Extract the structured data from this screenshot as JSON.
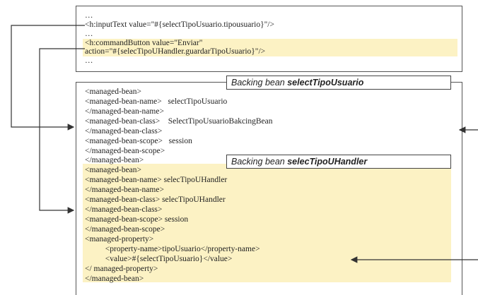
{
  "top_snippet": {
    "lines": [
      "…",
      "<h:inputText value=\"#{selectTipoUsuario.tipousuario}\"/>",
      "…",
      "<h:commandButton value=\"Enviar\"",
      "action=\"#{selecTipoUHandler.guardarTipoUsuario}\"/>",
      "…"
    ]
  },
  "labels": {
    "bean1_prefix": "Backing bean ",
    "bean1_name": "selectTipoUsuario",
    "bean2_prefix": "Backing bean ",
    "bean2_name": "selecTipoUHandler"
  },
  "config_snippet": {
    "lines": [
      "<managed-bean>",
      "<managed-bean-name>   selectTipoUsuario",
      "</managed-bean-name>",
      "<managed-bean-class>    SelectTipoUsuarioBakcingBean",
      "</managed-bean-class>",
      "<managed-bean-scope>   session",
      "</managed-bean-scope>",
      "</managed-bean>",
      "<managed-bean>",
      "<managed-bean-name> selecTipoUHandler",
      "</managed-bean-name>",
      "<managed-bean-class> selecTipoUHandler",
      "</managed-bean-class>",
      "<managed-bean-scope> session",
      "</managed-bean-scope>",
      "<managed-property>",
      "          <property-name>tipoUsuario</property-name>",
      "          <value>#{selectTipoUsuario}</value>",
      "</ managed-property>",
      "</managed-bean>"
    ]
  },
  "colors": {
    "highlight": "#fcf2c4",
    "border": "#555555",
    "arrow": "#333333"
  }
}
